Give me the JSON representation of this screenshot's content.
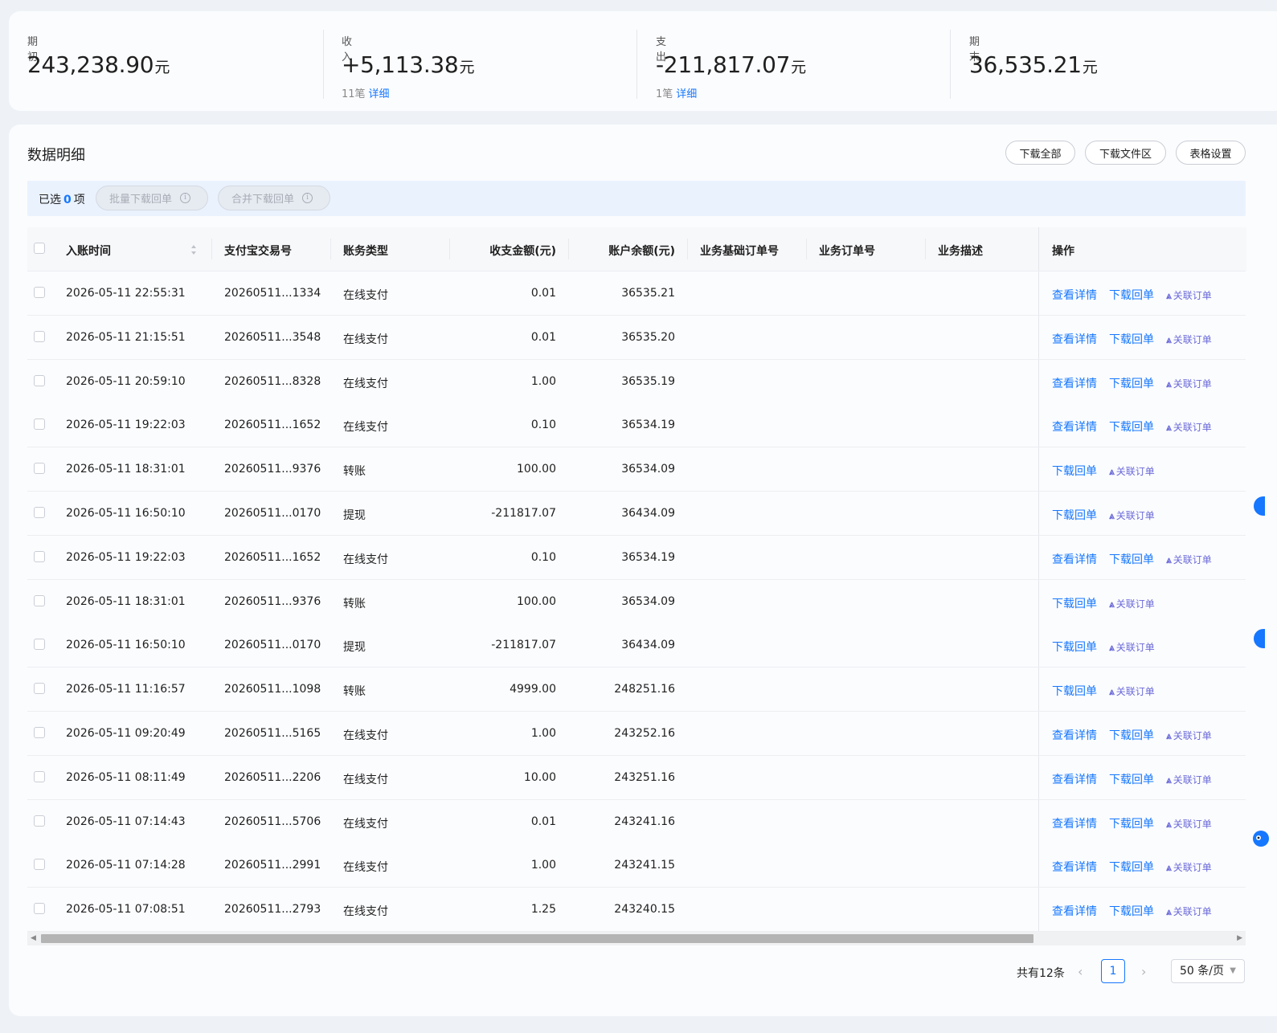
{
  "summary": {
    "opening": {
      "label": "期初",
      "value": "243,238.90",
      "unit": "元"
    },
    "income": {
      "label": "收入",
      "value": "+5,113.38",
      "unit": "元",
      "count": "11笔",
      "link": "详细"
    },
    "expense": {
      "label": "支出",
      "value": "-211,817.07",
      "unit": "元",
      "count": "1笔",
      "link": "详细"
    },
    "closing": {
      "label": "期末",
      "value": "36,535.21",
      "unit": "元"
    }
  },
  "detail": {
    "title": "数据明细",
    "buttons": {
      "download_all": "下载全部",
      "download_files": "下载文件区",
      "table_settings": "表格设置"
    },
    "selection": {
      "prefix": "已选",
      "count": "0",
      "suffix": "项",
      "batch_download": "批量下载回单",
      "merge_download": "合并下载回单"
    }
  },
  "table": {
    "headers": {
      "time": "入账时间",
      "trade_no": "支付宝交易号",
      "type": "账务类型",
      "amount": "收支金额(元)",
      "balance": "账户余额(元)",
      "base_order": "业务基础订单号",
      "order": "业务订单号",
      "desc": "业务描述",
      "ops": "操作"
    },
    "op_labels": {
      "view": "查看详情",
      "download": "下载回单",
      "link": "关联订单"
    },
    "rows": [
      {
        "time": "2026-05-11 22:55:31",
        "trade_no": "20260511...1334",
        "type": "在线支付",
        "amount": "0.01",
        "balance": "36535.21",
        "has_view": true
      },
      {
        "time": "2026-05-11 21:15:51",
        "trade_no": "20260511...3548",
        "type": "在线支付",
        "amount": "0.01",
        "balance": "36535.20",
        "has_view": true
      },
      {
        "time": "2026-05-11 20:59:10",
        "trade_no": "20260511...8328",
        "type": "在线支付",
        "amount": "1.00",
        "balance": "36535.19",
        "has_view": true
      },
      {
        "time": "2026-05-11 19:22:03",
        "trade_no": "20260511...1652",
        "type": "在线支付",
        "amount": "0.10",
        "balance": "36534.19",
        "has_view": true
      },
      {
        "time": "2026-05-11 18:31:01",
        "trade_no": "20260511...9376",
        "type": "转账",
        "amount": "100.00",
        "balance": "36534.09",
        "has_view": false
      },
      {
        "time": "2026-05-11 16:50:10",
        "trade_no": "20260511...0170",
        "type": "提现",
        "amount": "-211817.07",
        "balance": "36434.09",
        "has_view": false
      },
      {
        "time": "2026-05-11 19:22:03",
        "trade_no": "20260511...1652",
        "type": "在线支付",
        "amount": "0.10",
        "balance": "36534.19",
        "has_view": true
      },
      {
        "time": "2026-05-11 18:31:01",
        "trade_no": "20260511...9376",
        "type": "转账",
        "amount": "100.00",
        "balance": "36534.09",
        "has_view": false
      },
      {
        "time": "2026-05-11 16:50:10",
        "trade_no": "20260511...0170",
        "type": "提现",
        "amount": "-211817.07",
        "balance": "36434.09",
        "has_view": false
      },
      {
        "time": "2026-05-11 11:16:57",
        "trade_no": "20260511...1098",
        "type": "转账",
        "amount": "4999.00",
        "balance": "248251.16",
        "has_view": false
      },
      {
        "time": "2026-05-11 09:20:49",
        "trade_no": "20260511...5165",
        "type": "在线支付",
        "amount": "1.00",
        "balance": "243252.16",
        "has_view": true
      },
      {
        "time": "2026-05-11 08:11:49",
        "trade_no": "20260511...2206",
        "type": "在线支付",
        "amount": "10.00",
        "balance": "243251.16",
        "has_view": true
      },
      {
        "time": "2026-05-11 07:14:43",
        "trade_no": "20260511...5706",
        "type": "在线支付",
        "amount": "0.01",
        "balance": "243241.16",
        "has_view": true
      },
      {
        "time": "2026-05-11 07:14:28",
        "trade_no": "20260511...2991",
        "type": "在线支付",
        "amount": "1.00",
        "balance": "243241.15",
        "has_view": true
      },
      {
        "time": "2026-05-11 07:08:51",
        "trade_no": "20260511...2793",
        "type": "在线支付",
        "amount": "1.25",
        "balance": "243240.15",
        "has_view": true
      }
    ]
  },
  "pagination": {
    "total": "共有12条",
    "current": "1",
    "page_size": "50 条/页"
  },
  "colors": {
    "accent": "#1677ff",
    "link_purple": "#6b6ad9"
  }
}
